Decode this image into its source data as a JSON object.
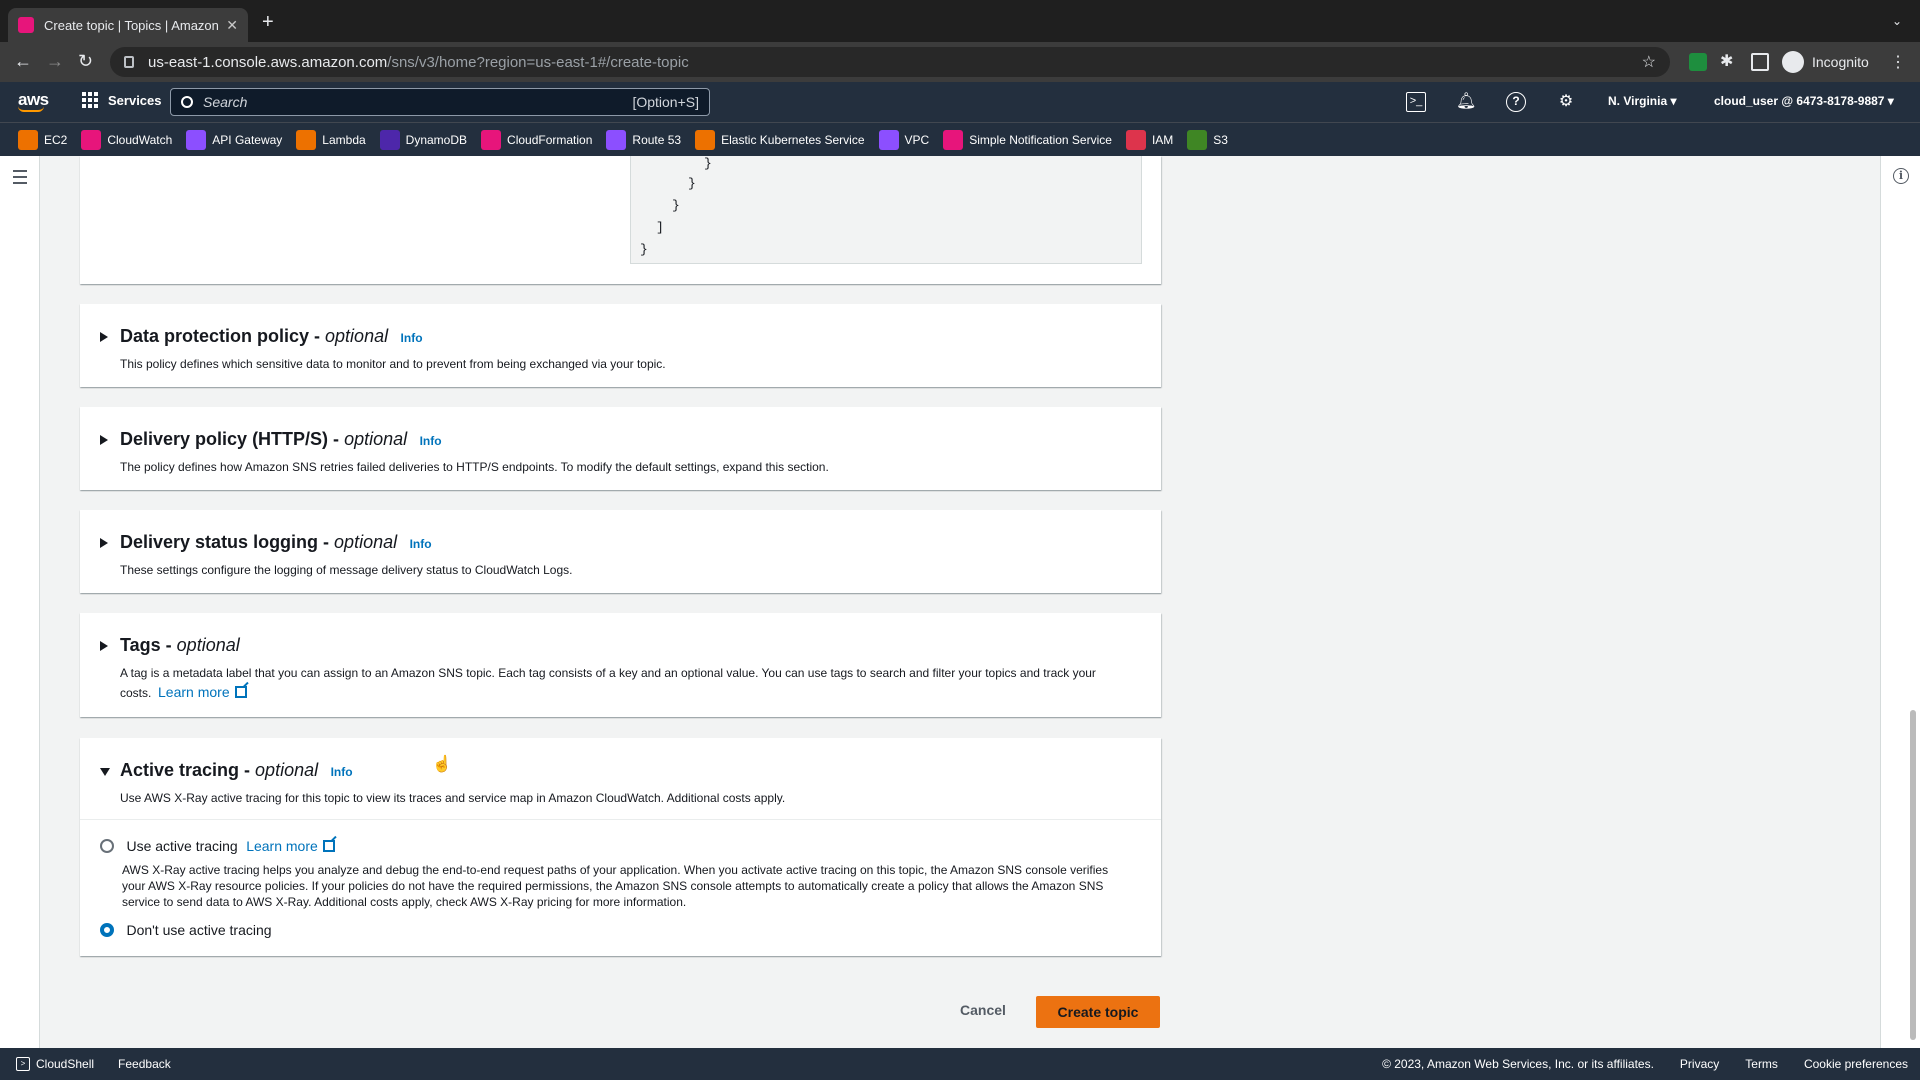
{
  "browser": {
    "tab_title": "Create topic | Topics | Amazon",
    "url_host": "us-east-1.console.aws.amazon.com",
    "url_path": "/sns/v3/home?region=us-east-1#/create-topic",
    "profile_label": "Incognito"
  },
  "aws_header": {
    "logo": "aws",
    "services_label": "Services",
    "search_placeholder": "Search",
    "search_shortcut": "[Option+S]",
    "region": "N. Virginia ▾",
    "account": "cloud_user @ 6473-8178-9887 ▾"
  },
  "favorites": [
    {
      "label": "EC2",
      "color": "#ed7100"
    },
    {
      "label": "CloudWatch",
      "color": "#e7157b"
    },
    {
      "label": "API Gateway",
      "color": "#8c4fff"
    },
    {
      "label": "Lambda",
      "color": "#ed7100"
    },
    {
      "label": "DynamoDB",
      "color": "#4d27aa"
    },
    {
      "label": "CloudFormation",
      "color": "#e7157b"
    },
    {
      "label": "Route 53",
      "color": "#8c4fff"
    },
    {
      "label": "Elastic Kubernetes Service",
      "color": "#ed7100"
    },
    {
      "label": "VPC",
      "color": "#8c4fff"
    },
    {
      "label": "Simple Notification Service",
      "color": "#e7157b"
    },
    {
      "label": "IAM",
      "color": "#dd344c"
    },
    {
      "label": "S3",
      "color": "#3f8624"
    }
  ],
  "code_lines": [
    "}",
    "}",
    "}",
    "]",
    "}"
  ],
  "sections": {
    "data_protection": {
      "title": "Data protection policy - ",
      "optional": "optional",
      "info": "Info",
      "desc": "This policy defines which sensitive data to monitor and to prevent from being exchanged via your topic."
    },
    "delivery_policy": {
      "title": "Delivery policy (HTTP/S) - ",
      "optional": "optional",
      "info": "Info",
      "desc": "The policy defines how Amazon SNS retries failed deliveries to HTTP/S endpoints. To modify the default settings, expand this section."
    },
    "delivery_logging": {
      "title": "Delivery status logging - ",
      "optional": "optional",
      "info": "Info",
      "desc": "These settings configure the logging of message delivery status to CloudWatch Logs."
    },
    "tags": {
      "title": "Tags - ",
      "optional": "optional",
      "desc": "A tag is a metadata label that you can assign to an Amazon SNS topic. Each tag consists of a key and an optional value. You can use tags to search and filter your topics and track your costs.",
      "learn_more": "Learn more"
    },
    "active_tracing": {
      "title": "Active tracing - ",
      "optional": "optional",
      "info": "Info",
      "desc": "Use AWS X-Ray active tracing for this topic to view its traces and service map in Amazon CloudWatch. Additional costs apply.",
      "option_use": "Use active tracing",
      "option_use_learn": "Learn more",
      "option_use_desc": "AWS X-Ray active tracing helps you analyze and debug the end-to-end request paths of your application. When you activate active tracing on this topic, the Amazon SNS console verifies your AWS X-Ray resource policies. If your policies do not have the required permissions, the Amazon SNS console attempts to automatically create a policy that allows the Amazon SNS service to send data to AWS X-Ray. Additional costs apply, check AWS X-Ray pricing for more information.",
      "option_dont": "Don't use active tracing",
      "selected": "dont"
    }
  },
  "actions": {
    "cancel": "Cancel",
    "create": "Create topic"
  },
  "footer": {
    "cloudshell": "CloudShell",
    "feedback": "Feedback",
    "copyright": "© 2023, Amazon Web Services, Inc. or its affiliates.",
    "privacy": "Privacy",
    "terms": "Terms",
    "cookies": "Cookie preferences"
  }
}
